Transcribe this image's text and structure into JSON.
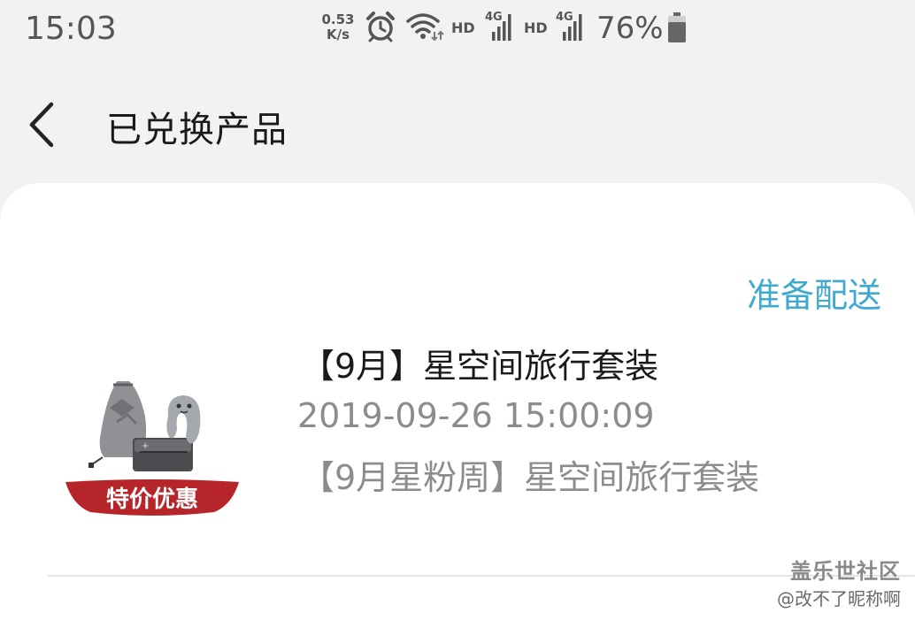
{
  "status_bar": {
    "time": "15:03",
    "net_speed_value": "0.53",
    "net_speed_unit": "K/s",
    "hd_label_1": "HD",
    "hd_label_2": "HD",
    "network_type_1": "4G",
    "network_type_2": "4G",
    "battery_percent": "76%",
    "battery_level": 0.76,
    "icons": [
      "alarm-icon",
      "wifi-icon",
      "signal-icon",
      "signal-icon",
      "battery-icon"
    ]
  },
  "header": {
    "back_icon": "chevron-left-icon",
    "title": "已兑换产品"
  },
  "order": {
    "status": "准备配送",
    "status_color": "#3fa9d0",
    "product_name": "【9月】星空间旅行套装",
    "date": "2019-09-26 15:00:09",
    "description": "【9月星粉周】星空间旅行套装",
    "image_badge": "特价优惠",
    "badge_color": "#b5252a"
  },
  "watermark": {
    "brand": "盖乐世社区",
    "user": "@改不了昵称啊"
  }
}
